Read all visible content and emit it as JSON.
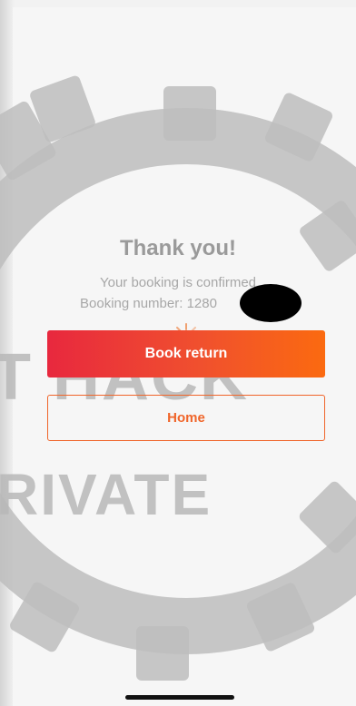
{
  "confirmation": {
    "title": "Thank you!",
    "subtitle": "Your booking is confirmed",
    "booking_label": "Booking number: 1280"
  },
  "actions": {
    "book_return": "Book return",
    "home": "Home"
  },
  "watermark": {
    "line1": "T HACK",
    "line2": "RIVATE"
  },
  "colors": {
    "accent_orange": "#f0652a",
    "gradient_start": "#e8283e",
    "gradient_end": "#fb6a10"
  }
}
